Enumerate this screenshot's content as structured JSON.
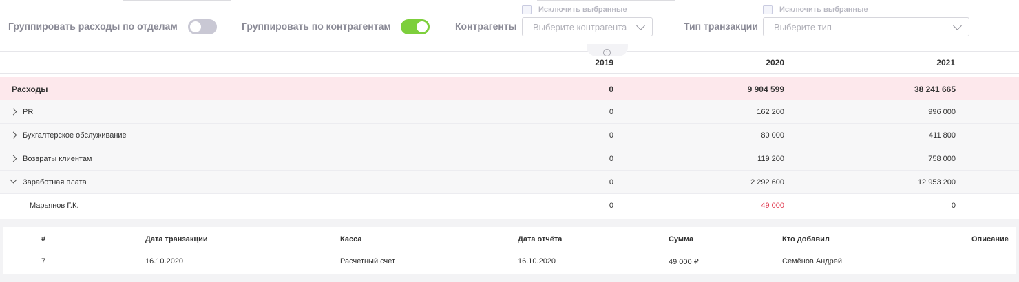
{
  "filters": {
    "group_by_departments": {
      "label": "Группировать расходы по отделам",
      "enabled": false
    },
    "group_by_counterparties": {
      "label": "Группировать по контрагентам",
      "enabled": true
    },
    "counterparties": {
      "label": "Контрагенты",
      "exclude_label": "Исключить выбранные",
      "placeholder": "Выберите контрагента"
    },
    "transaction_type": {
      "label": "Тип транзакции",
      "exclude_label": "Исключить выбранные",
      "placeholder": "Выберите тип"
    }
  },
  "table": {
    "years": [
      "2019",
      "2020",
      "2021"
    ],
    "total": {
      "label": "Расходы",
      "values": [
        "0",
        "9 904 599",
        "38 241 665"
      ]
    },
    "rows": [
      {
        "label": "PR",
        "values": [
          "0",
          "162 200",
          "996 000"
        ],
        "expanded": false
      },
      {
        "label": "Бухгалтерское обслуживание",
        "values": [
          "0",
          "80 000",
          "411 800"
        ],
        "expanded": false
      },
      {
        "label": "Возвраты клиентам",
        "values": [
          "0",
          "119 200",
          "758 000"
        ],
        "expanded": false
      },
      {
        "label": "Заработная плата",
        "values": [
          "0",
          "2 292 600",
          "12 953 200"
        ],
        "expanded": true
      }
    ],
    "subrow": {
      "label": "Марьянов Г.К.",
      "values": [
        "0",
        "49 000",
        "0"
      ],
      "highlight_color": "#e0394f"
    }
  },
  "transactions": {
    "headers": [
      "#",
      "Дата транзакции",
      "Касса",
      "Дата отчёта",
      "Сумма",
      "Кто добавил",
      "Описание"
    ],
    "rows": [
      {
        "num": "7",
        "transaction_date": "16.10.2020",
        "cashbox": "Расчетный счет",
        "report_date": "16.10.2020",
        "amount": "49 000 ₽",
        "added_by": "Семёнов Андрей",
        "description": ""
      }
    ]
  },
  "colors": {
    "toggle_on": "#7dcf3c",
    "toggle_off": "#c9c8d4",
    "total_row_bg": "#fde8ec",
    "negative_red": "#e0394f"
  }
}
